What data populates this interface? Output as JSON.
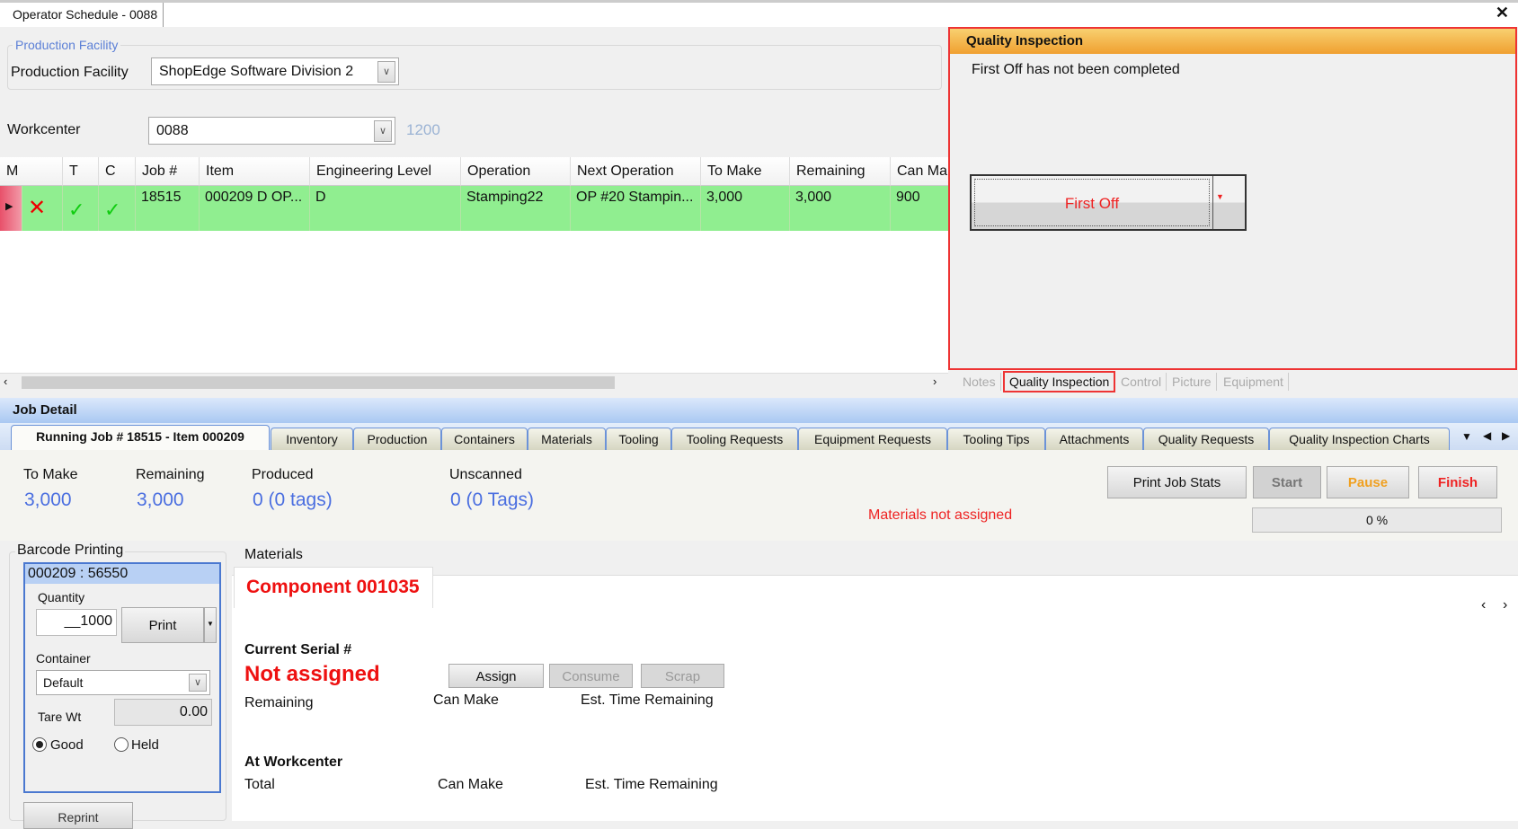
{
  "window": {
    "tab_title": "Operator Schedule - 0088",
    "close_icon": "close-icon"
  },
  "facility": {
    "group_label": "Production Facility",
    "label": "Production Facility",
    "value": "ShopEdge Software Division 2"
  },
  "workcenter": {
    "label": "Workcenter",
    "value": "0088",
    "count": "1200"
  },
  "grid": {
    "columns": [
      "M",
      "T",
      "C",
      "Job #",
      "Item",
      "Engineering Level",
      "Operation",
      "Next Operation",
      "To Make",
      "Remaining",
      "Can Ma"
    ],
    "rows": [
      {
        "m": "x-icon",
        "t": "check-icon",
        "c": "check-icon",
        "job": "18515",
        "item": "000209  D  OP...",
        "eng": "D",
        "operation": "Stamping22",
        "next_operation": "OP  #20  Stampin...",
        "to_make": "3,000",
        "remaining": "3,000",
        "can_make": "900"
      }
    ],
    "row_color": "#90ee90"
  },
  "quality_inspection": {
    "title": "Quality Inspection",
    "message": "First Off has not been completed",
    "button": "First Off",
    "accent": "#f0a030"
  },
  "side_tabs": [
    "Notes",
    "Quality Inspection",
    "Control",
    "Picture",
    "Equipment"
  ],
  "job_detail": {
    "title": "Job Detail",
    "tabs": [
      "Running Job # 18515 - Item 000209",
      "Inventory",
      "Production",
      "Containers",
      "Materials",
      "Tooling",
      "Tooling Requests",
      "Equipment Requests",
      "Tooling Tips",
      "Attachments",
      "Quality Requests",
      "Quality Inspection Charts"
    ],
    "stats": {
      "to_make_label": "To Make",
      "to_make": "3,000",
      "remaining_label": "Remaining",
      "remaining": "3,000",
      "produced_label": "Produced",
      "produced": "0 (0 tags)",
      "unscanned_label": "Unscanned",
      "unscanned": "0 (0 Tags)"
    },
    "warning": "Materials not assigned",
    "buttons": {
      "print": "Print Job Stats",
      "start": "Start",
      "pause": "Pause",
      "finish": "Finish"
    },
    "progress": {
      "label": "0 %",
      "value": 0
    }
  },
  "barcode": {
    "group_label": "Barcode Printing",
    "item": "000209 : 56550",
    "quantity_label": "Quantity",
    "quantity": "__1000",
    "print": "Print",
    "container_label": "Container",
    "container": "Default",
    "tare_label": "Tare Wt",
    "tare": "0.00",
    "good": "Good",
    "held": "Held",
    "selected": "Good",
    "reprint": "Reprint"
  },
  "materials": {
    "label": "Materials",
    "component": "Component 001035",
    "serial_label": "Current Serial #",
    "serial": "Not assigned",
    "assign": "Assign",
    "consume": "Consume",
    "scrap": "Scrap",
    "remaining": "Remaining",
    "can_make": "Can Make",
    "est_time": "Est. Time Remaining",
    "at_workcenter": "At Workcenter",
    "total": "Total",
    "can_make2": "Can Make",
    "est_time2": "Est. Time Remaining"
  }
}
